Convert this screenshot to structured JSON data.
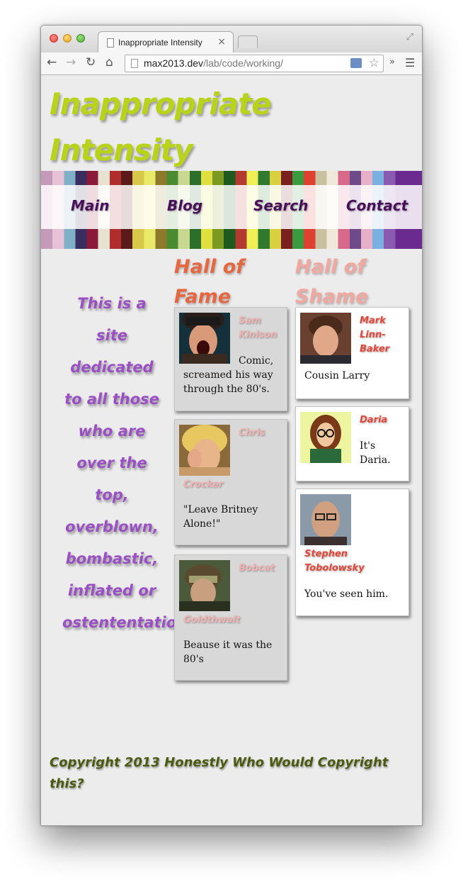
{
  "browser": {
    "tab_title": "Inappropriate Intensity",
    "tab_close": "×",
    "url_host": "max2013.dev",
    "url_path": "/lab/code/working/",
    "more": "»"
  },
  "site": {
    "title": "Inappropriate Intensity",
    "nav": [
      "Main",
      "Blog",
      "Search",
      "Contact"
    ],
    "intro": "This is a site dedicated to all those who are over the top, overblown, bombastic, inflated or ostententatious."
  },
  "fame": {
    "heading": "Hall of Fame",
    "cards": [
      {
        "name": "Sam Kinison",
        "desc": "Comic, screamed his way through the 80's."
      },
      {
        "name": "Chris Crocker",
        "desc": "\"Leave Britney Alone!\""
      },
      {
        "name": "Bobcat Goldthwait",
        "desc": "Beause it was the 80's"
      }
    ]
  },
  "shame": {
    "heading": "Hall of Shame",
    "cards": [
      {
        "name": "Mark Linn-Baker",
        "desc": "Cousin Larry"
      },
      {
        "name": "Daria",
        "desc": "It's Daria."
      },
      {
        "name": "Stephen Tobolowsky",
        "desc": "You've seen him."
      }
    ]
  },
  "footer": {
    "copyright": "Copyright 2013 Honestly Who Would Copyright this?"
  }
}
